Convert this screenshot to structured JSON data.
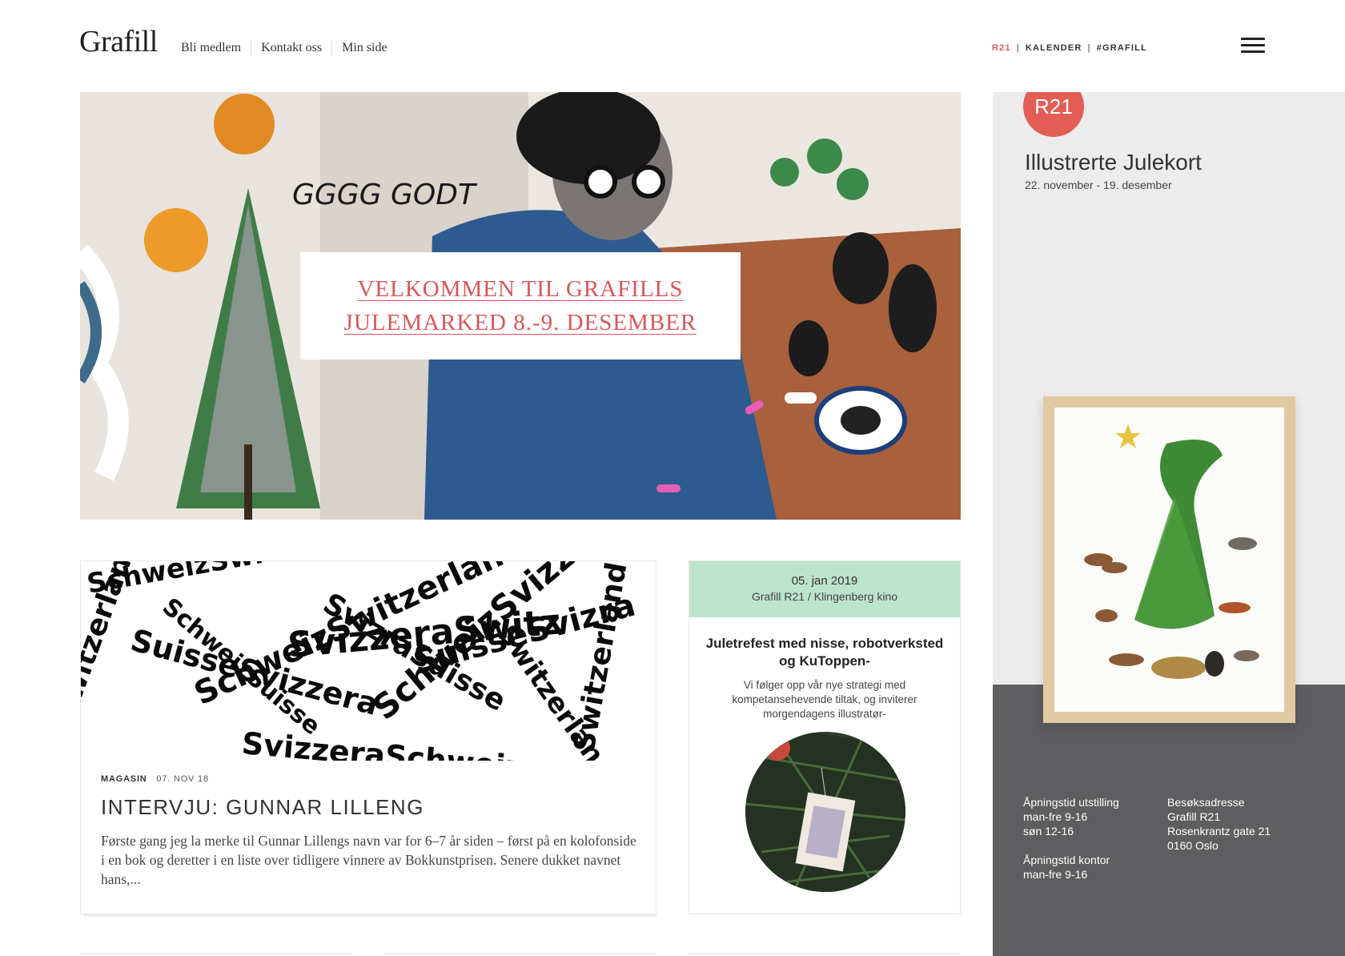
{
  "header": {
    "logo": "Grafill",
    "nav": [
      "Bli medlem",
      "Kontakt oss",
      "Min side"
    ],
    "topbar": {
      "r21": "R21",
      "sep": "|",
      "kalender": "KALENDER",
      "grafill": "#GRAFILL"
    }
  },
  "hero": {
    "title": "VELKOMMEN TIL GRAFILLS JULEMARKED 8.-9. DESEMBER",
    "art_text": "GGGG GODT"
  },
  "article": {
    "category": "MAGASIN",
    "date": "07. NOV 18",
    "title": "INTERVJU: GUNNAR LILLENG",
    "excerpt": "Første gang jeg la merke til Gunnar Lillengs navn var for 6–7 år siden – først på en kolofonside i en bok og deretter i en liste over tidligere vinnere av Bokkunstprisen. Senere dukket navnet hans,..."
  },
  "event": {
    "date": "05. jan 2019",
    "location": "Grafill R21 / Klingenberg kino",
    "title": "Juletrefest med nisse, robotverksted og KuToppen-",
    "description": "Vi følger opp vår nye strategi med kompetansehevende tiltak, og inviterer morgendagens illustratør-"
  },
  "panel": {
    "badge": "R21",
    "title": "Illustrerte Julekort",
    "dates": "22. november - 19. desember",
    "hours_exhibit_label": "Åpningstid utstilling",
    "hours_exhibit_1": "man-fre 9-16",
    "hours_exhibit_2": "søn 12-16",
    "hours_office_label": "Åpningstid kontor",
    "hours_office_1": "man-fre 9-16",
    "address_label": "Besøksadresse",
    "address_1": "Grafill R21",
    "address_2": "Rosenkrantz gate 21",
    "address_3": "0160 Oslo"
  },
  "colors": {
    "accent_red": "#e05a55",
    "event_header_green": "#bde3cf",
    "floor_gray": "#5e5d5f"
  },
  "icons": {
    "menu": "hamburger-menu-icon"
  }
}
